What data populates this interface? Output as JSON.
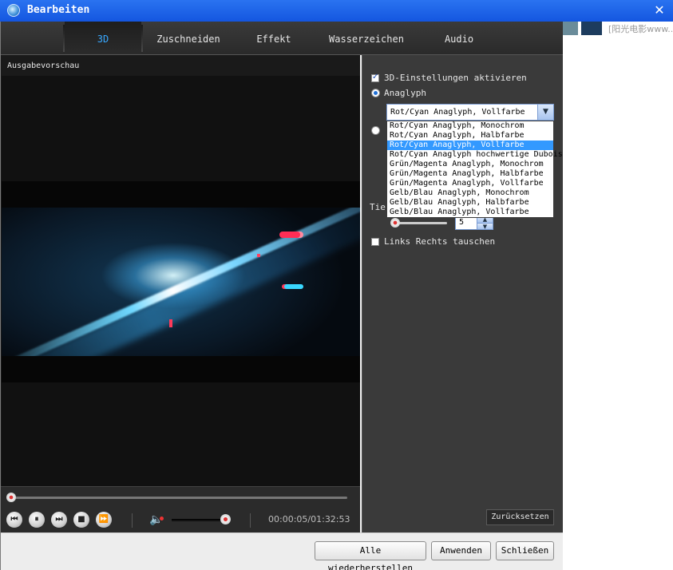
{
  "window": {
    "title": "Bearbeiten",
    "close_symbol": "✕"
  },
  "background_app": {
    "text": "[阳光电影www..."
  },
  "tabs": [
    {
      "label": "3D",
      "active": true
    },
    {
      "label": "Zuschneiden",
      "active": false
    },
    {
      "label": "Effekt",
      "active": false
    },
    {
      "label": "Wasserzeichen",
      "active": false
    },
    {
      "label": "Audio",
      "active": false
    }
  ],
  "preview": {
    "label": "Ausgabevorschau",
    "timecode": "00:00:05/01:32:53",
    "seek_fraction": 0.0,
    "volume_fraction": 1.0
  },
  "controls": {
    "rewind": "⏮",
    "pause": "⏸",
    "forward": "⏭",
    "stop": "■",
    "next": "⏩",
    "volume_icon": "🔈"
  },
  "settings": {
    "enable_3d_label": "3D-Einstellungen aktivieren",
    "enable_3d_checked": true,
    "anaglyph_label": "Anaglyph",
    "anaglyph_checked": true,
    "anaglyph_selected": "Rot/Cyan Anaglyph, Vollfarbe",
    "anaglyph_options": [
      "Rot/Cyan Anaglyph, Monochrom",
      "Rot/Cyan Anaglyph, Halbfarbe",
      "Rot/Cyan Anaglyph, Vollfarbe",
      "Rot/Cyan Anaglyph hochwertige Dubois",
      "Grün/Magenta Anaglyph, Monochrom",
      "Grün/Magenta Anaglyph, Halbfarbe",
      "Grün/Magenta Anaglyph, Vollfarbe",
      "Gelb/Blau Anaglyph, Monochrom",
      "Gelb/Blau Anaglyph, Halbfarbe",
      "Gelb/Blau Anaglyph, Vollfarbe"
    ],
    "selected_index": 2,
    "depth_label": "Tie",
    "depth_value": "5",
    "swap_label": "Links Rechts tauschen",
    "swap_checked": false,
    "reset_label": "Zurücksetzen"
  },
  "footer": {
    "restore_all": "Alle wiederherstellen",
    "apply": "Anwenden",
    "close": "Schließen"
  },
  "colors": {
    "title_bar": "#1a5fe8",
    "active_tab": "#39a8ff",
    "selection": "#3399ff"
  }
}
